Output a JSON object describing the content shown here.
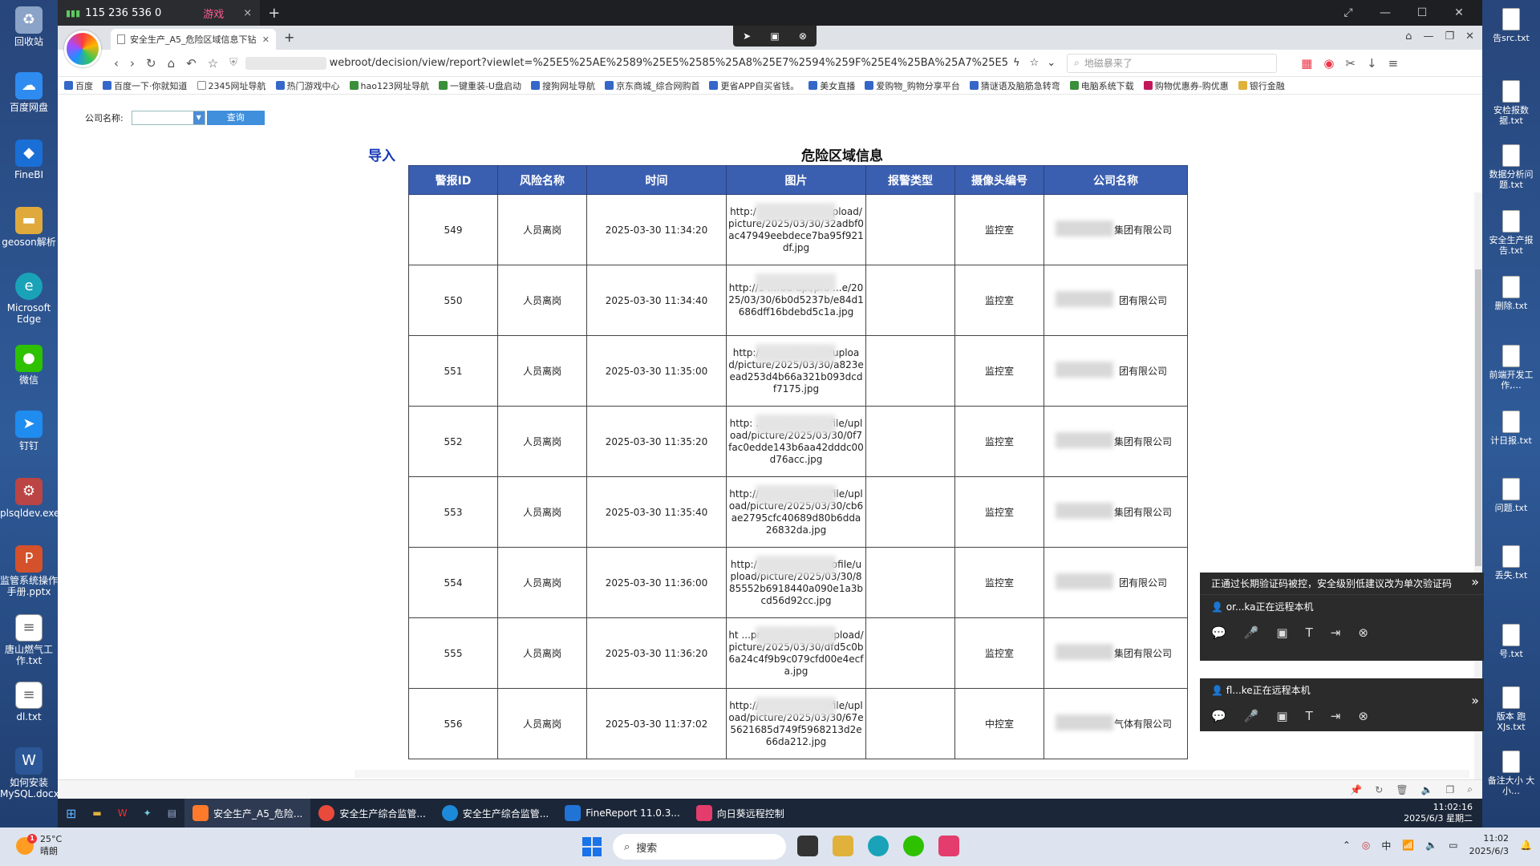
{
  "remote_bar": {
    "tab_label": "115 236 536 0",
    "game_label": "游戏",
    "close": "×",
    "new": "+"
  },
  "desktop_left": [
    {
      "label": "回收站",
      "color": "#8aa3c7"
    },
    {
      "label": "百度网盘",
      "color": "#2e8cf0"
    },
    {
      "label": "FineBI",
      "color": "#1a6fd6"
    },
    {
      "label": "geoson解析",
      "color": "#e0a93b"
    },
    {
      "label": "Microsoft Edge",
      "color": "#1aa3b8"
    },
    {
      "label": "微信",
      "color": "#2dc100"
    },
    {
      "label": "钉钉",
      "color": "#1f8cf0"
    },
    {
      "label": "plsqldev.exe",
      "color": "#b44"
    },
    {
      "label": "监管系统操作手册.pptx",
      "color": "#d4512b"
    },
    {
      "label": "唐山燃气工作.txt",
      "color": "#ffffff"
    },
    {
      "label": "dl.txt",
      "color": "#ffffff"
    },
    {
      "label": "如何安装MySQL.docx",
      "color": "#2b5797"
    }
  ],
  "desktop_right": [
    "告src.txt",
    "安检报数据.txt",
    "数据分析问题.txt",
    "安全生产报告.txt",
    "删除.txt",
    "前端开发工作,…",
    "计日报.txt",
    "问题.txt",
    "丢失.txt",
    "号.txt",
    "版本 跑 XJs.txt",
    "备注大小 大小…"
  ],
  "browser": {
    "tab_title": "安全生产_A5_危险区域信息下钻",
    "address": "webroot/decision/view/report?viewlet=%25E5%25AE%2589%25E5%2585%25A8%25E7%2594%259F%25E4%25BA%25A7%25E5",
    "search_placeholder": "地磁暴来了",
    "bookmarks": [
      "百度",
      "百度一下·你就知道",
      "2345网址导航",
      "热门游戏中心",
      "hao123网址导航",
      "一键重装-U盘启动",
      "搜狗网址导航",
      "京东商城_综合网购首",
      "更省APP自买省钱。",
      "美女直播",
      "爱购物_购物分享平台",
      "猜谜语及脑筋急转弯",
      "电脑系统下载",
      "购物优惠券-购优惠",
      "银行金融"
    ]
  },
  "report": {
    "filter_label": "公司名称:",
    "query_label": "查询",
    "import_label": "导入",
    "title": "危险区域信息",
    "columns": [
      "警报ID",
      "风险名称",
      "时间",
      "图片",
      "报警类型",
      "摄像头编号",
      "公司名称"
    ],
    "rows": [
      {
        "id": "549",
        "risk": "人员离岗",
        "time": "2025-03-30 11:34:20",
        "url": "http:/ ...l-api/profile/upload/picture/2025/03/30/32adbf0ac47949eebdece7ba95f921df.jpg",
        "type": "",
        "camera": "监控室",
        "company": "集团有限公司"
      },
      {
        "id": "550",
        "risk": "人员离岗",
        "time": "2025-03-30 11:34:40",
        "url": "http://1 ...rod-api/pro ...e/2025/03/30/6b0d5237b/e84d1686dff16bdebd5c1a.jpg",
        "type": "",
        "camera": "监控室",
        "company": "团有限公司"
      },
      {
        "id": "551",
        "risk": "人员离岗",
        "time": "2025-03-30 11:35:00",
        "url": "http:/ ...d-api/profile/upload/picture/2025/03/30/a823eead253d4b66a321b093dcdf7175.jpg",
        "type": "",
        "camera": "监控室",
        "company": "团有限公司"
      },
      {
        "id": "552",
        "risk": "人员离岗",
        "time": "2025-03-30 11:35:20",
        "url": "http: ...'/prod-api/profile/upload/picture/2025/03/30/0f7fac0edde143b6aa42dddc00d76acc.jpg",
        "type": "",
        "camera": "监控室",
        "company": "集团有限公司"
      },
      {
        "id": "553",
        "risk": "人员离岗",
        "time": "2025-03-30 11:35:40",
        "url": "http:// ...prod-api/profile/upload/picture/2025/03/30/cb6ae2795cfc40689d80b6dda26832da.jpg",
        "type": "",
        "camera": "监控室",
        "company": "集团有限公司"
      },
      {
        "id": "554",
        "risk": "人员离岗",
        "time": "2025-03-30 11:36:00",
        "url": "http:/ ...4/prod-api/profile/upload/picture/2025/03/30/885552b6918440a090e1a3bcd56d92cc.jpg",
        "type": "",
        "camera": "监控室",
        "company": "团有限公司"
      },
      {
        "id": "555",
        "risk": "人员离岗",
        "time": "2025-03-30 11:36:20",
        "url": "ht ...prod-api/profile/upload/picture/2025/03/30/dfd5c0b6a24c4f9b9c079cfd00e4ecfa.jpg",
        "type": "",
        "camera": "监控室",
        "company": "集团有限公司"
      },
      {
        "id": "556",
        "risk": "人员离岗",
        "time": "2025-03-30 11:37:02",
        "url": "http:// ...prod-api/profile/upload/picture/2025/03/30/67e5621685d749f5968213d2e66da212.jpg",
        "type": "",
        "camera": "中控室",
        "company": "气体有限公司"
      }
    ]
  },
  "remote_panels": [
    {
      "notice": "正通过长期验证码被控，安全级别低建议改为单次验证码",
      "user": "or...ka正在远程本机"
    },
    {
      "notice": "",
      "user": "fl...ke正在远程本机"
    }
  ],
  "inner_taskbar": {
    "items": [
      {
        "label": "安全生产_A5_危险...",
        "color": "#ff7a2a"
      },
      {
        "label": "安全生产综合监管...",
        "color": "#e84b3c"
      },
      {
        "label": "安全生产综合监管...",
        "color": "#1c8ad8"
      },
      {
        "label": "FineReport 11.0.3...",
        "color": "#2173d6"
      },
      {
        "label": "向日葵远程控制",
        "color": "#e43c6c"
      }
    ],
    "time": "11:02:16",
    "date": "2025/6/3 星期二"
  },
  "taskbar": {
    "temp": "25°C",
    "weather": "晴朗",
    "badge": "1",
    "search_label": "搜索",
    "ime": "中",
    "time": "11:02",
    "date": "2025/6/3"
  }
}
